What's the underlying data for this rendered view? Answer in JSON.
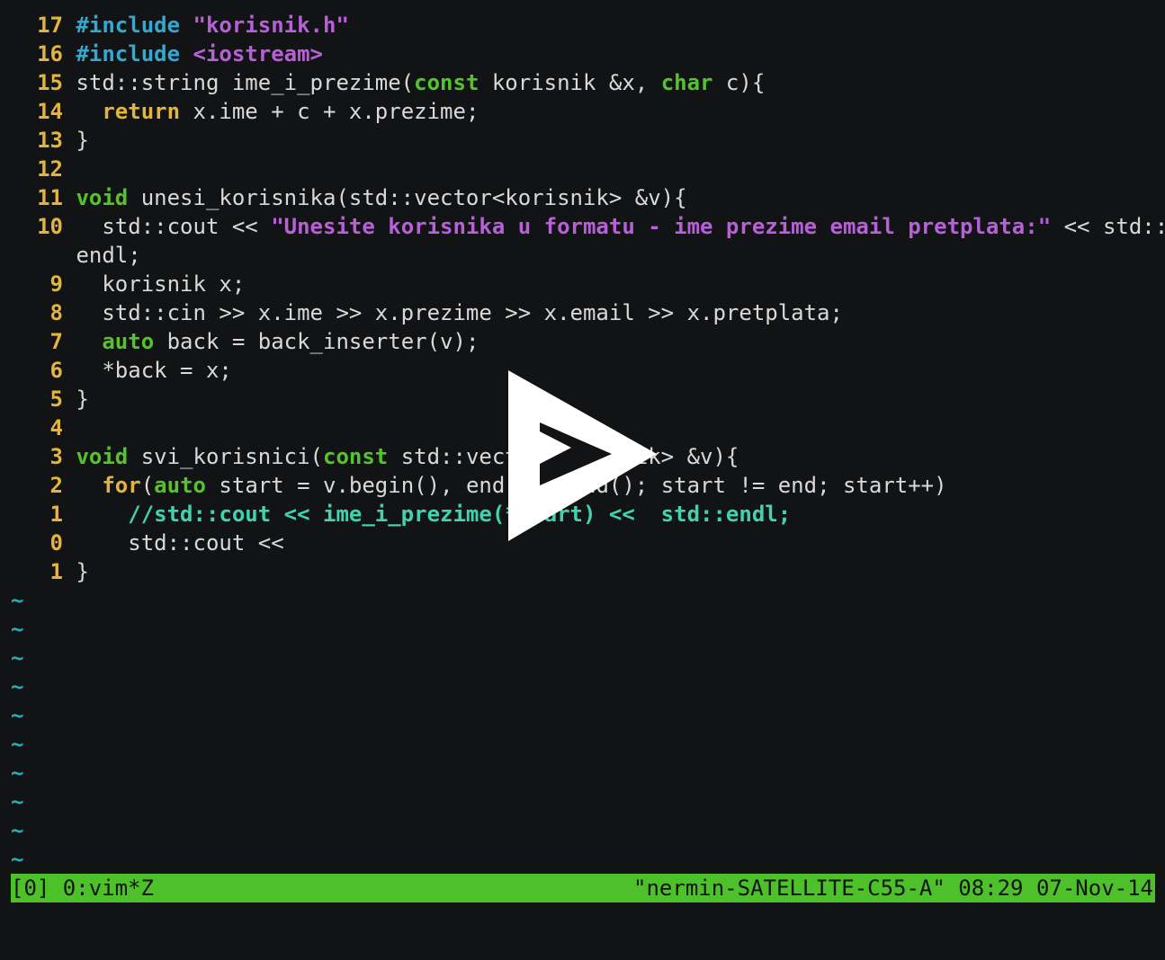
{
  "editor": {
    "lines": [
      {
        "num": "17",
        "parts": [
          {
            "t": "#include",
            "c": "k-blue"
          },
          {
            "t": " "
          },
          {
            "t": "\"korisnik.h\"",
            "c": "k-purple"
          }
        ]
      },
      {
        "num": "16",
        "parts": [
          {
            "t": "#include",
            "c": "k-blue"
          },
          {
            "t": " "
          },
          {
            "t": "<iostream>",
            "c": "k-purple"
          }
        ]
      },
      {
        "num": "15",
        "parts": [
          {
            "t": "std::string ime_i_prezime("
          },
          {
            "t": "const",
            "c": "k-green"
          },
          {
            "t": " korisnik &x, "
          },
          {
            "t": "char",
            "c": "k-green"
          },
          {
            "t": " c){"
          }
        ]
      },
      {
        "num": "14",
        "parts": [
          {
            "t": "  "
          },
          {
            "t": "return",
            "c": "k-yellow"
          },
          {
            "t": " x.ime + c + x.prezime;"
          }
        ]
      },
      {
        "num": "13",
        "parts": [
          {
            "t": "}"
          }
        ]
      },
      {
        "num": "12",
        "parts": []
      },
      {
        "num": "11",
        "parts": [
          {
            "t": "void",
            "c": "k-green"
          },
          {
            "t": " unesi_korisnika(std::vector<korisnik> &v){"
          }
        ]
      },
      {
        "num": "10",
        "parts": [
          {
            "t": "  std::cout << "
          },
          {
            "t": "\"Unesite korisnika u formatu - ime prezime email pretplata:\"",
            "c": "k-purple"
          },
          {
            "t": " << std::"
          }
        ]
      },
      {
        "num": "",
        "parts": [
          {
            "t": "endl;"
          }
        ]
      },
      {
        "num": "9",
        "parts": [
          {
            "t": "  korisnik x;"
          }
        ]
      },
      {
        "num": "8",
        "parts": [
          {
            "t": "  std::cin >> x.ime >> x.prezime >> x.email >> x.pretplata;"
          }
        ]
      },
      {
        "num": "7",
        "parts": [
          {
            "t": "  "
          },
          {
            "t": "auto",
            "c": "k-green"
          },
          {
            "t": " back = back_inserter(v);"
          }
        ]
      },
      {
        "num": "6",
        "parts": [
          {
            "t": "  *back = x;"
          }
        ]
      },
      {
        "num": "5",
        "parts": [
          {
            "t": "}"
          }
        ]
      },
      {
        "num": "4",
        "parts": []
      },
      {
        "num": "3",
        "parts": [
          {
            "t": "void",
            "c": "k-green"
          },
          {
            "t": " svi_korisnici("
          },
          {
            "t": "const",
            "c": "k-green"
          },
          {
            "t": " std::vector<korisnik> &v){"
          }
        ]
      },
      {
        "num": "2",
        "parts": [
          {
            "t": "  "
          },
          {
            "t": "for",
            "c": "k-yellow"
          },
          {
            "t": "("
          },
          {
            "t": "auto",
            "c": "k-green"
          },
          {
            "t": " start = v.begin(), end = v.end(); start != end; start++)"
          }
        ]
      },
      {
        "num": "1",
        "parts": [
          {
            "t": "    "
          },
          {
            "t": "//std::cout << ime_i_prezime(*start) <<  std::endl;",
            "c": "k-teal"
          }
        ]
      },
      {
        "num": "0",
        "parts": [
          {
            "t": "    std::cout <<"
          }
        ]
      },
      {
        "num": "1",
        "parts": [
          {
            "t": "}"
          }
        ]
      }
    ],
    "tilde_char": "~",
    "tilde_count": 10
  },
  "statusbar": {
    "left": "[0] 0:vim*Z",
    "right": "\"nermin-SATELLITE-C55-A\" 08:29 07-Nov-14"
  },
  "overlay": {
    "icon": "play-icon",
    "color": "#ffffff"
  }
}
